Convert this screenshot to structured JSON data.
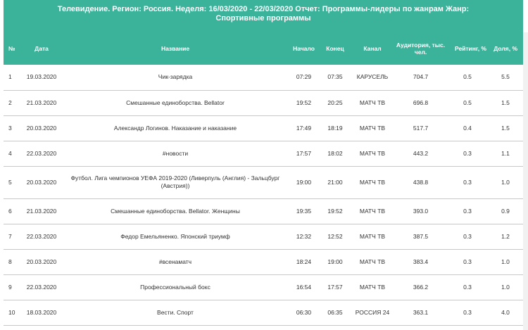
{
  "report": {
    "title": "Телевидение. Регион: Россия. Неделя: 16/03/2020 - 22/03/2020 Отчет: Программы-лидеры по жанрам Жанр: Спортивные программы"
  },
  "table": {
    "headers": {
      "num": "№",
      "date": "Дата",
      "name": "Название",
      "start": "Начало",
      "end": "Конец",
      "channel": "Канал",
      "audience": "Аудитория, тыс. чел.",
      "rating": "Рейтинг, %",
      "share": "Доля, %"
    },
    "rows": [
      {
        "num": "1",
        "date": "19.03.2020",
        "name": "Чик-зарядка",
        "start": "07:29",
        "end": "07:35",
        "channel": "КАРУСЕЛЬ",
        "audience": "704.7",
        "rating": "0.5",
        "share": "5.5"
      },
      {
        "num": "2",
        "date": "21.03.2020",
        "name": "Смешанные единоборства. Bellator",
        "start": "19:52",
        "end": "20:25",
        "channel": "МАТЧ ТВ",
        "audience": "696.8",
        "rating": "0.5",
        "share": "1.5"
      },
      {
        "num": "3",
        "date": "20.03.2020",
        "name": "Александр Логинов. Наказание и наказание",
        "start": "17:49",
        "end": "18:19",
        "channel": "МАТЧ ТВ",
        "audience": "517.7",
        "rating": "0.4",
        "share": "1.5"
      },
      {
        "num": "4",
        "date": "22.03.2020",
        "name": "#новости",
        "start": "17:57",
        "end": "18:02",
        "channel": "МАТЧ ТВ",
        "audience": "443.2",
        "rating": "0.3",
        "share": "1.1"
      },
      {
        "num": "5",
        "date": "20.03.2020",
        "name": "Футбол. Лига чемпионов УЕФА 2019-2020 (Ливерпуль (Англия) - Зальцбург (Австрия))",
        "start": "19:00",
        "end": "21:00",
        "channel": "МАТЧ ТВ",
        "audience": "438.8",
        "rating": "0.3",
        "share": "1.0"
      },
      {
        "num": "6",
        "date": "21.03.2020",
        "name": "Смешанные единоборства. Bellator. Женщины",
        "start": "19:35",
        "end": "19:52",
        "channel": "МАТЧ ТВ",
        "audience": "393.0",
        "rating": "0.3",
        "share": "0.9"
      },
      {
        "num": "7",
        "date": "22.03.2020",
        "name": "Федор Емельяненко. Японский триумф",
        "start": "12:32",
        "end": "12:52",
        "channel": "МАТЧ ТВ",
        "audience": "387.5",
        "rating": "0.3",
        "share": "1.2"
      },
      {
        "num": "8",
        "date": "20.03.2020",
        "name": "#всенаматч",
        "start": "18:24",
        "end": "19:00",
        "channel": "МАТЧ ТВ",
        "audience": "383.4",
        "rating": "0.3",
        "share": "1.0"
      },
      {
        "num": "9",
        "date": "22.03.2020",
        "name": "Профессиональный бокс",
        "start": "16:54",
        "end": "17:57",
        "channel": "МАТЧ ТВ",
        "audience": "366.2",
        "rating": "0.3",
        "share": "1.0"
      },
      {
        "num": "10",
        "date": "18.03.2020",
        "name": "Вести. Спорт",
        "start": "06:30",
        "end": "06:35",
        "channel": "РОССИЯ 24",
        "audience": "363.1",
        "rating": "0.3",
        "share": "4.0"
      }
    ]
  }
}
